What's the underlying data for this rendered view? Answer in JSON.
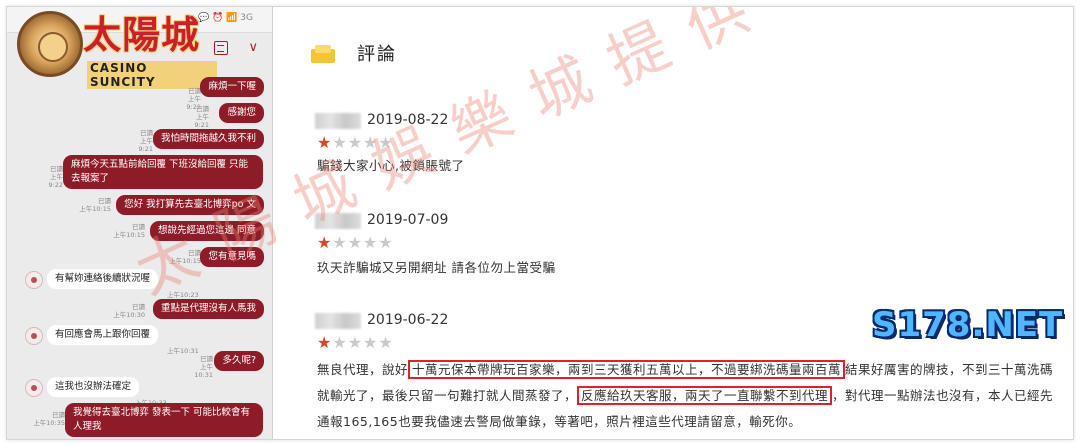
{
  "phone": {
    "status_text": "💬 ⏰ 📶 3G",
    "logo": {
      "title": "太陽城",
      "subtitle": "CASINO SUNCITY"
    },
    "messages_out": [
      {
        "text": "麻煩一下喔",
        "read": "已讀",
        "time": "上午9:21"
      },
      {
        "text": "感謝您",
        "read": "已讀",
        "time": "上午9:21"
      },
      {
        "text": "我怕時間拖越久我不利",
        "read": "已讀",
        "time": "上午9:21"
      },
      {
        "text": "麻煩今天五點前給回覆 下班沒給回覆 只能去報案了",
        "read": "已讀",
        "time": "上午9:22"
      },
      {
        "text": "您好 我打算先去臺北博弈po 文",
        "read": "已讀",
        "time": "上午10:15"
      },
      {
        "text": "想說先經過您這邊 同意",
        "read": "已讀",
        "time": "上午10:15"
      },
      {
        "text": "您有意見嗎",
        "read": "已讀",
        "time": "上午10:15"
      },
      {
        "text": "重點是代理沒有人馬我",
        "read": "已讀",
        "time": "上午10:30"
      },
      {
        "text": "多久呢?",
        "read": "已讀",
        "time": "上午10:31"
      },
      {
        "text": "我覺得去臺北博弈 發表一下 可能比較會有人理我",
        "read": "已讀",
        "time": "上午10:35"
      }
    ],
    "messages_in": [
      {
        "text": "有幫妳連絡後續狀況喔",
        "time": "上午10:23"
      },
      {
        "text": "有回應會馬上跟你回覆",
        "time": "上午10:31"
      },
      {
        "text": "這我也沒辦法確定",
        "time": "上午10:33"
      }
    ]
  },
  "reviews": {
    "heading": "評論",
    "items": [
      {
        "date": "2019-08-22",
        "stars_on": 1,
        "stars_total": 5,
        "text": "騙錢大家小心,被鎖賬號了"
      },
      {
        "date": "2019-07-09",
        "stars_on": 1,
        "stars_total": 5,
        "text": "玖天詐騙城又另開網址 請各位勿上當受騙"
      },
      {
        "date": "2019-06-22",
        "stars_on": 1,
        "stars_total": 5,
        "text_parts": [
          "無良代理，說好",
          "十萬元保本帶牌玩百家樂，兩到三天獲利五萬以上，不過要綁洗碼量兩百萬",
          "結果好厲害的牌技，不到三十萬洗碼就輸光了，最後只留一句難打就人間蒸發了，",
          "反應給玖天客服，兩天了一直聯繫不到代理",
          "，對代理一點辦法也沒有，本人已經先通報165,165也要我儘速去警局做筆錄，等著吧，照片裡這些代理請留意，輸死你。"
        ]
      }
    ]
  },
  "badge": "S178.NET",
  "watermark": "太陽城娛樂城提供",
  "colors": {
    "chat_bubble": "#8e1c28",
    "star_on": "#d9452b",
    "star_off": "#c9c9c9",
    "highlight_box": "#e0202a",
    "badge": "#4fb6ff"
  }
}
